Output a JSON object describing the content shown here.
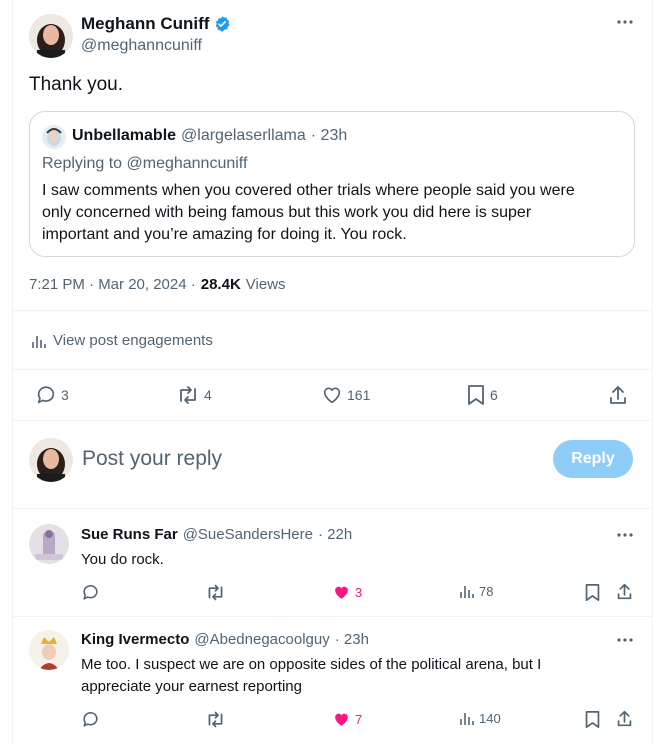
{
  "main_tweet": {
    "author_name": "Meghann Cuniff",
    "author_handle": "@meghanncuniff",
    "text": "Thank you.",
    "more_icon": "more-horizontal-icon",
    "verified_icon": "verified-badge-icon",
    "quote": {
      "author_name": "Unbellamable",
      "author_handle": "@largelaserllama",
      "time": "· 23h",
      "replying_to": "Replying to @meghanncuniff",
      "text_lines": [
        "I saw comments when you covered other trials where people said you were",
        "only concerned with being famous but this work you did here is super",
        "important and you’re amazing for doing it. You rock."
      ]
    },
    "timestamp": "7:21 PM · Mar 20, 2024 ·",
    "views_count": "28.4K",
    "views_label": "Views",
    "engagements_label": "View post engagements",
    "actions": {
      "replies": "3",
      "reposts": "4",
      "likes": "161",
      "bookmarks": "6"
    }
  },
  "composer": {
    "placeholder": "Post your reply",
    "button_label": "Reply"
  },
  "replies": [
    {
      "author_name": "Sue Runs Far",
      "author_handle": "@SueSandersHere",
      "time": "· 22h",
      "text_lines": [
        "You do rock."
      ],
      "likes": "3",
      "views": "78"
    },
    {
      "author_name": "King Ivermecto",
      "author_handle": "@Abednegacoolguy",
      "time": "· 23h",
      "text_lines": [
        "Me too. I suspect we are on opposite sides of the political arena, but I",
        "appreciate your earnest reporting"
      ],
      "likes": "7",
      "views": "140"
    }
  ],
  "colors": {
    "accent": "#1d9bf0",
    "reply_button_disabled": "#8ecdf8",
    "like_active": "#f91880",
    "muted_text": "#536471",
    "border": "#eff3f4"
  }
}
